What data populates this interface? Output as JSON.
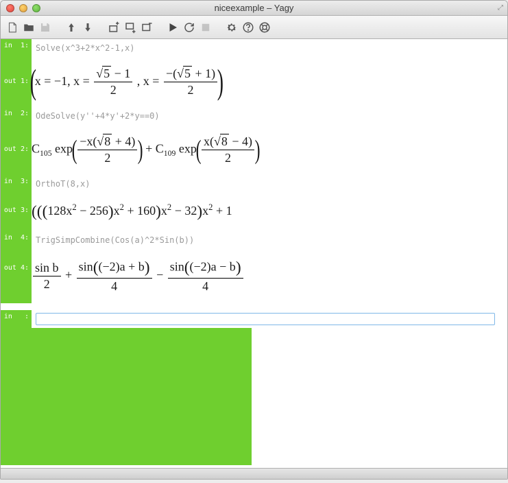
{
  "window": {
    "title": "niceexample – Yagy"
  },
  "cells": {
    "in1": {
      "label": "in  1:",
      "code": "Solve(x^3+2*x^2-1,x)"
    },
    "out1": {
      "label": "out 1:"
    },
    "in2": {
      "label": "in  2:",
      "code": "OdeSolve(y''+4*y'+2*y==0)"
    },
    "out2": {
      "label": "out 2:"
    },
    "in3": {
      "label": "in  3:",
      "code": "OrthoT(8,x)"
    },
    "out3": {
      "label": "out 3:"
    },
    "in4": {
      "label": "in  4:",
      "code": "TrigSimpCombine(Cos(a)^2*Sin(b))"
    },
    "out4": {
      "label": "out 4:"
    },
    "in5": {
      "label": "in   :"
    }
  },
  "math_out1": {
    "parts": [
      "x = −1, x = ",
      " , x = "
    ],
    "frac1_num_a": "5",
    "frac1_num_b": " − 1",
    "frac1_den": "2",
    "frac2_num_a": "−(",
    "frac2_num_b": "5",
    "frac2_num_c": " + 1)",
    "frac2_den": "2"
  },
  "math_out2": {
    "c1": "C",
    "c1sub": "105",
    "exp": " exp",
    "f1_num_a": "−x(",
    "f1_num_b": "8",
    "f1_num_c": " + 4)",
    "f1_den": "2",
    "plus": " + ",
    "c2": "C",
    "c2sub": "109",
    "f2_num_a": "x(",
    "f2_num_b": "8",
    "f2_num_c": " − 4)",
    "f2_den": "2"
  },
  "math_out3": {
    "a": "128x",
    "b": " − 256",
    "c": "x",
    "d": " + 160",
    "e": "x",
    "f": " − 32",
    "g": "x",
    "h": " + 1",
    "sq": "2"
  },
  "math_out4": {
    "t1n": "sin b",
    "t1d": "2",
    "op1": " + ",
    "t2n_a": "sin",
    "t2n_b": "(−2)a + b",
    "t2d": "4",
    "op2": " − ",
    "t3n_a": "sin",
    "t3n_b": "(−2)a − b",
    "t3d": "4"
  },
  "colors": {
    "gutter": "#6fcf2f",
    "inputBorder": "#7fb8e8"
  }
}
